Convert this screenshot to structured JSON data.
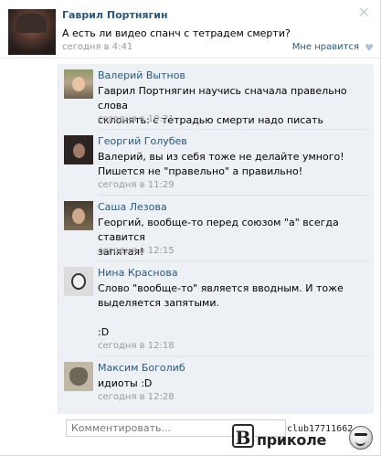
{
  "post": {
    "author": "Гаврил Портнягин",
    "text": "А есть ли видео спанч с тетрадем смерти?",
    "time": "сегодня в 4:41",
    "like_label": "Мне нравится",
    "like_icon": "heart-icon",
    "close_icon": "close-icon"
  },
  "comments": [
    {
      "author": "Валерий Вытнов",
      "text": "Гаврил Портнягин научись сначала правельно слова\nсклонять: с тетрадью смерти надо писать",
      "time": "сегодня в 10:21"
    },
    {
      "author": "Георгий Голубев",
      "text": "Валерий, вы из себя тоже не делайте умного!\nПишется не \"правельно\" а правильно!",
      "time": "сегодня в 11:29"
    },
    {
      "author": "Саша Лезова",
      "text": "Георгий, вообще-то перед союзом \"а\" всегда ставится\nзапятая!",
      "time": "сегодня в 12:15"
    },
    {
      "author": "Нина Краснова",
      "text": "Слово \"вообще-то\" является вводным. И тоже\nвыделяется запятыми.\n\n:D",
      "time": "сегодня в 12:18"
    },
    {
      "author": "Максим Боголиб",
      "text": "идиоты :D",
      "time": "сегодня в 12:28"
    }
  ],
  "comment_input": {
    "placeholder": "Комментировать..."
  },
  "watermark": {
    "letter": "В",
    "word": "приколе",
    "club": "club17711662"
  }
}
